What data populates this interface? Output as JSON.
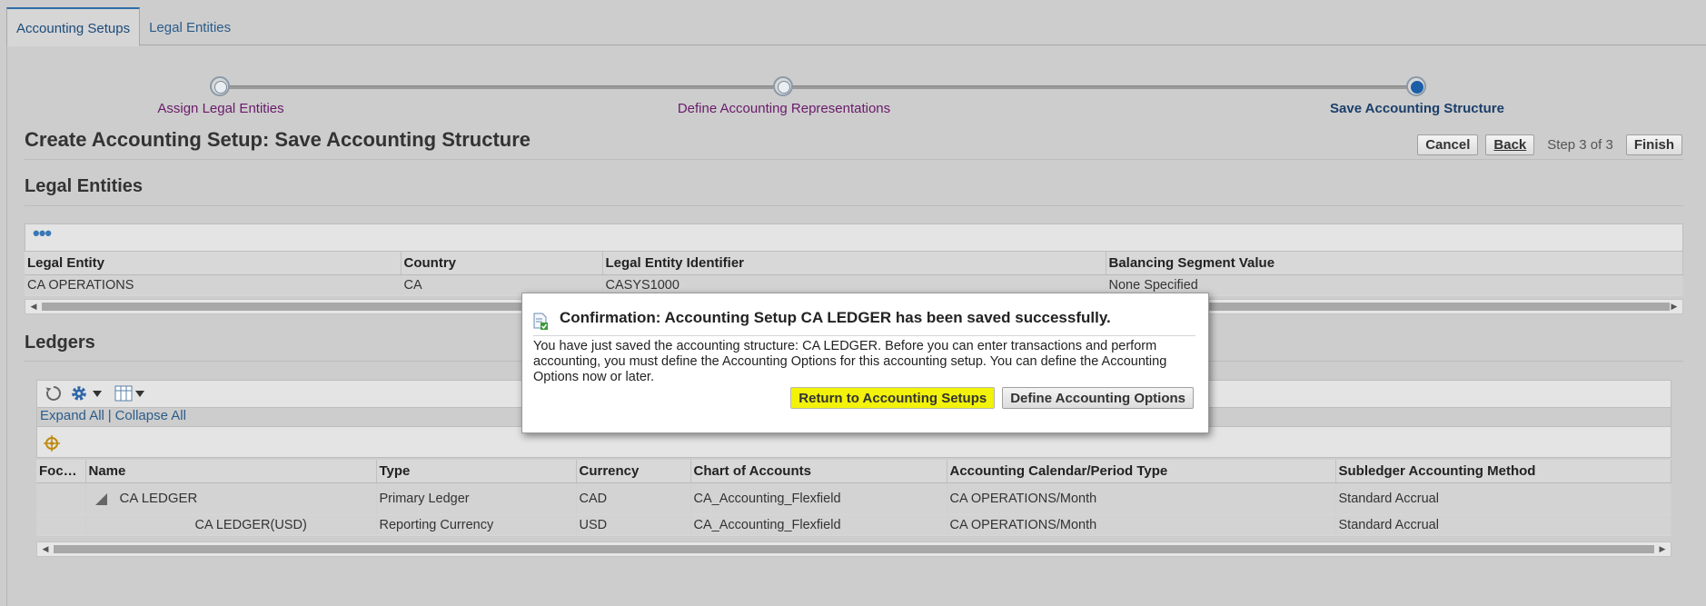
{
  "tabs": [
    {
      "label": "Accounting Setups",
      "active": true
    },
    {
      "label": "Legal Entities",
      "active": false
    }
  ],
  "train": {
    "steps": [
      {
        "label": "Assign Legal Entities",
        "status": "visited"
      },
      {
        "label": "Define Accounting Representations",
        "status": "visited"
      },
      {
        "label": "Save Accounting Structure",
        "status": "current"
      }
    ]
  },
  "page": {
    "title": "Create Accounting Setup: Save Accounting Structure",
    "cancel": "Cancel",
    "back": "Back",
    "step_text": "Step 3 of 3",
    "finish": "Finish"
  },
  "legal_entities": {
    "heading": "Legal Entities",
    "columns": [
      "Legal Entity",
      "Country",
      "Legal Entity Identifier",
      "Balancing Segment Value"
    ],
    "rows": [
      [
        "CA OPERATIONS",
        "CA",
        "CASYS1000",
        "None Specified"
      ]
    ]
  },
  "ledgers": {
    "heading": "Ledgers",
    "expand_all": "Expand All",
    "separator": "|",
    "collapse_all": "Collapse All",
    "columns": [
      "Foc…",
      "Name",
      "Type",
      "Currency",
      "Chart of Accounts",
      "Accounting Calendar/Period Type",
      "Subledger Accounting Method"
    ],
    "rows": [
      {
        "focus": "",
        "name": "CA LEDGER",
        "type": "Primary Ledger",
        "currency": "CAD",
        "coa": "CA_Accounting_Flexfield",
        "calendar": "CA OPERATIONS/Month",
        "method": "Standard Accrual"
      },
      {
        "focus": "",
        "name": "CA LEDGER(USD)",
        "type": "Reporting Currency",
        "currency": "USD",
        "coa": "CA_Accounting_Flexfield",
        "calendar": "CA OPERATIONS/Month",
        "method": "Standard Accrual"
      }
    ]
  },
  "dialog": {
    "title": "Confirmation: Accounting Setup CA LEDGER has been saved successfully.",
    "body": "You have just saved the accounting structure: CA LEDGER. Before you can enter transactions and perform accounting, you must define the Accounting Options for this accounting setup. You can define the Accounting Options now or later.",
    "return_button": "Return to Accounting Setups",
    "define_button": "Define Accounting Options",
    "highlight_color": "#f2f20a"
  },
  "colors": {
    "link": "#2b5c8a",
    "visited_step": "#6a1a6a",
    "current_step": "#1c5fa8"
  }
}
